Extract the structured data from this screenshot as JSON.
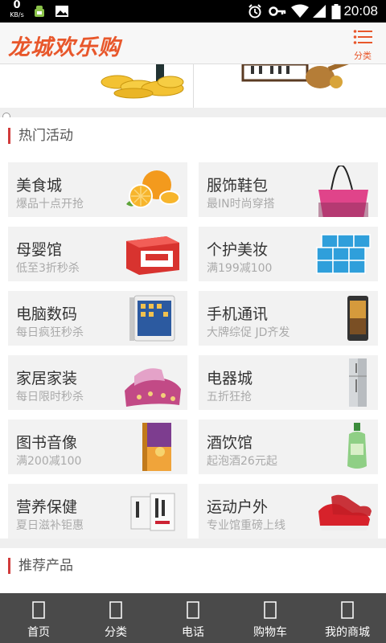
{
  "status_bar": {
    "speed_value": "0",
    "speed_unit": "KB/s",
    "time": "20:08",
    "icons": [
      "android-debug-icon",
      "image-icon",
      "alarm-icon",
      "key-icon",
      "wifi-icon",
      "signal-icon",
      "battery-icon"
    ]
  },
  "header": {
    "logo_text": "龙城欢乐购",
    "menu_label": "分类",
    "accent_color": "#e8572b"
  },
  "hot": {
    "title": "热门活动",
    "tiles": [
      {
        "title": "美食城",
        "subtitle": "爆品十点开抢",
        "icon": "oranges-icon"
      },
      {
        "title": "服饰鞋包",
        "subtitle": "最IN时尚穿搭",
        "icon": "handbag-icon"
      },
      {
        "title": "母婴馆",
        "subtitle": "低至3折秒杀",
        "icon": "diaper-box-icon"
      },
      {
        "title": "个护美妆",
        "subtitle": "满199减100",
        "icon": "tissue-pack-icon"
      },
      {
        "title": "电脑数码",
        "subtitle": "每日疯狂秒杀",
        "icon": "tablet-icon"
      },
      {
        "title": "手机通讯",
        "subtitle": "大牌综促 JD齐发",
        "icon": "smartphone-icon"
      },
      {
        "title": "家居家装",
        "subtitle": "每日限时秒杀",
        "icon": "bedding-icon"
      },
      {
        "title": "电器城",
        "subtitle": "五折狂抢",
        "icon": "refrigerator-icon"
      },
      {
        "title": "图书音像",
        "subtitle": "满200减100",
        "icon": "book-icon"
      },
      {
        "title": "酒饮馆",
        "subtitle": "起泡酒26元起",
        "icon": "liquor-bottle-icon"
      },
      {
        "title": "营养保健",
        "subtitle": "夏日滋补钜惠",
        "icon": "supplement-box-icon"
      },
      {
        "title": "运动户外",
        "subtitle": "专业馆重磅上线",
        "icon": "sneaker-icon"
      }
    ]
  },
  "recommend": {
    "title": "推荐产品"
  },
  "tabbar": {
    "items": [
      {
        "label": "首页",
        "icon": "home-icon"
      },
      {
        "label": "分类",
        "icon": "category-icon"
      },
      {
        "label": "电话",
        "icon": "phone-icon"
      },
      {
        "label": "购物车",
        "icon": "cart-icon"
      },
      {
        "label": "我的商城",
        "icon": "user-icon"
      }
    ]
  }
}
